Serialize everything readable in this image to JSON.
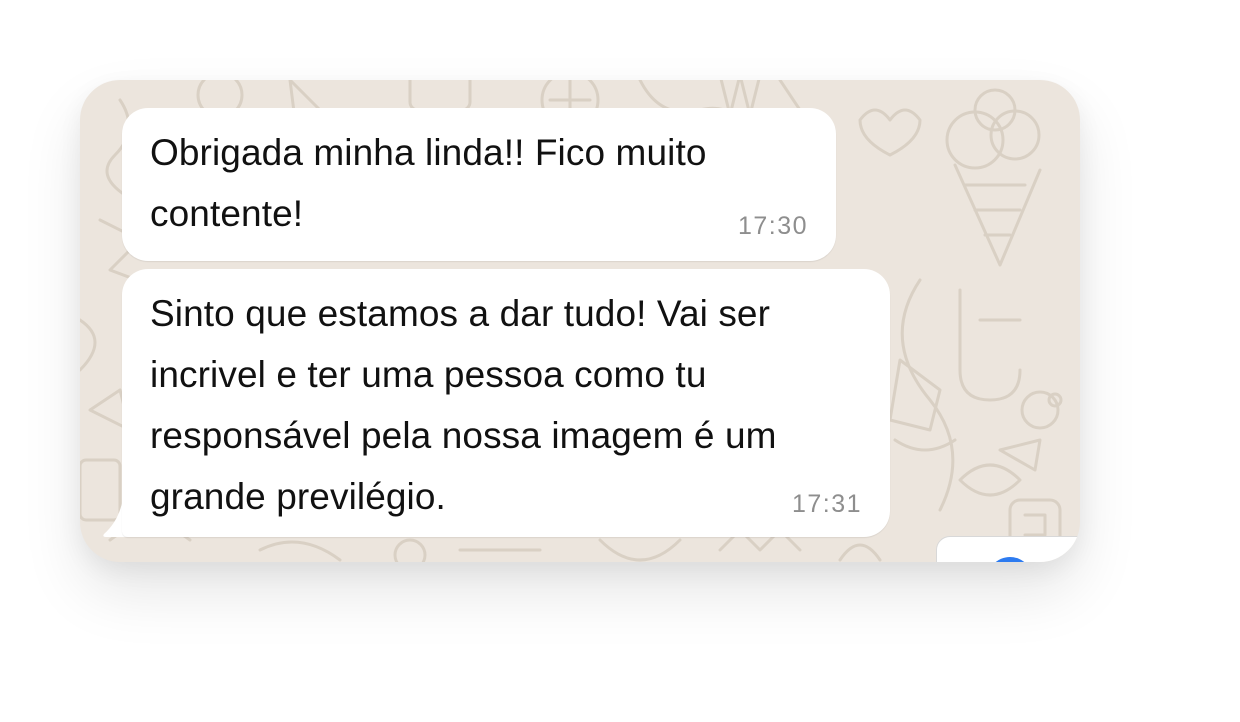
{
  "chat": {
    "messages": [
      {
        "text": "Obrigada minha linda!! Fico muito\ncontente!",
        "time": "17:30"
      },
      {
        "text": "Sinto que estamos a dar tudo! Vai ser\nincrivel e ter uma pessoa como tu\nresponsável pela nossa imagem é um\ngrande previlégio.",
        "time": "17:31"
      }
    ]
  },
  "colors": {
    "wallpaper": "#ece5dd",
    "bubble": "#ffffff",
    "text": "#111111",
    "timestamp": "#8e8e8e",
    "accent": "#2d7bf0"
  },
  "icons": {
    "wallpaper_pattern": "doodle-pattern"
  }
}
